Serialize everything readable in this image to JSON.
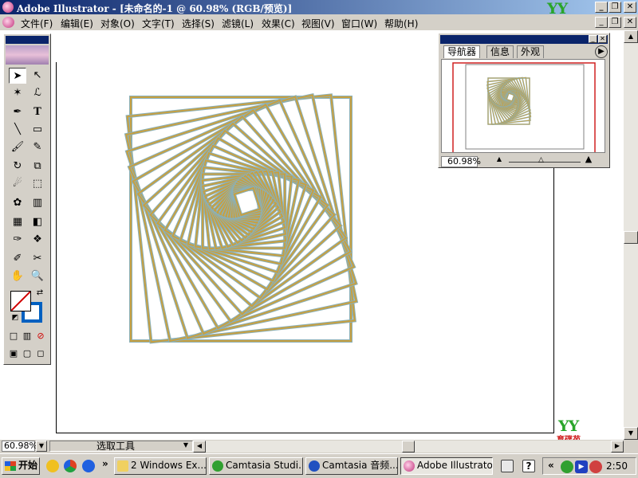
{
  "window": {
    "title": "Adobe Illustrator - [未命名的-1 @ 60.98% (RGB/预览)]"
  },
  "logo": {
    "text": "YY",
    "caption": "育碟苑"
  },
  "menu": [
    {
      "label": "文件(F)"
    },
    {
      "label": "编辑(E)"
    },
    {
      "label": "对象(O)"
    },
    {
      "label": "文字(T)"
    },
    {
      "label": "选择(S)"
    },
    {
      "label": "滤镜(L)"
    },
    {
      "label": "效果(C)"
    },
    {
      "label": "视图(V)"
    },
    {
      "label": "窗口(W)"
    },
    {
      "label": "帮助(H)"
    }
  ],
  "navigator": {
    "tabs": [
      {
        "label": "导航器"
      },
      {
        "label": "信息"
      },
      {
        "label": "外观"
      }
    ],
    "zoom": "60.98%",
    "zoom_level": 0.45
  },
  "statusbar": {
    "zoom": "60.98%",
    "status": "选取工具"
  },
  "taskbar": {
    "start": "开始",
    "tasks": [
      {
        "label": "2 Windows Ex..."
      },
      {
        "label": "Camtasia Studi..."
      },
      {
        "label": "Camtasia 音频..."
      },
      {
        "label": "Adobe Illustrato..."
      }
    ],
    "clock": "2:50"
  },
  "colors": {
    "stroke_outer": "#8ab0b8",
    "stroke_inner": "#c8a040",
    "titlebar": "#0a246a"
  },
  "icons": {
    "tools": [
      "selection-tool-icon",
      "direct-selection-tool-icon",
      "magic-wand-icon",
      "lasso-icon",
      "pen-tool-icon",
      "type-tool-icon",
      "line-tool-icon",
      "rectangle-tool-icon",
      "paintbrush-icon",
      "pencil-icon",
      "rotate-tool-icon",
      "scale-tool-icon",
      "warp-tool-icon",
      "free-transform-icon",
      "symbol-sprayer-icon",
      "graph-tool-icon",
      "mesh-tool-icon",
      "gradient-tool-icon",
      "eyedropper-icon",
      "blend-tool-icon",
      "slice-tool-icon",
      "scissors-icon",
      "hand-tool-icon",
      "zoom-tool-icon"
    ]
  }
}
